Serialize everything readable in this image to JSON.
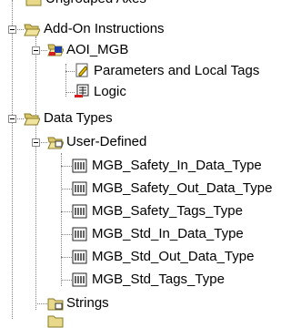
{
  "tree": {
    "partial_top_label": "Ungrouped Axes",
    "add_on_instructions": {
      "label": "Add-On Instructions",
      "aoi": {
        "label": "AOI_MGB",
        "children": [
          "Parameters and Local Tags",
          "Logic"
        ]
      }
    },
    "data_types": {
      "label": "Data Types",
      "user_defined": {
        "label": "User-Defined",
        "children": [
          "MGB_Safety_In_Data_Type",
          "MGB_Safety_Out_Data_Type",
          "MGB_Safety_Tags_Type",
          "MGB_Std_In_Data_Type",
          "MGB_Std_Out_Data_Type",
          "MGB_Std_Tags_Type"
        ]
      },
      "strings": {
        "label": "Strings"
      }
    }
  },
  "colors": {
    "folder_fill": "#e8d88a",
    "folder_stroke": "#8a7a2a",
    "tree_lines": "#808080"
  }
}
